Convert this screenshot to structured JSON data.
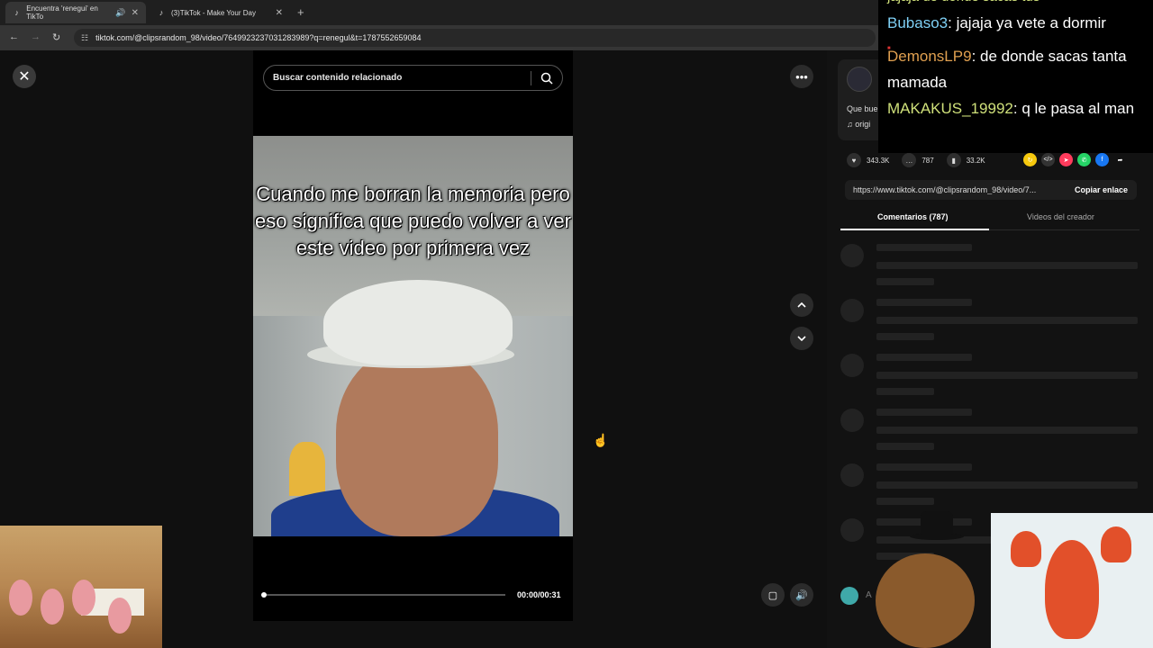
{
  "browser": {
    "tabs": [
      {
        "title": "Encuentra 'renegui' en TikTo",
        "active": true
      },
      {
        "title": "(3)TikTok - Make Your Day",
        "active": false
      }
    ],
    "url": "tiktok.com/@clipsrandom_98/video/7649923237031283989?q=renegul&t=1787552659084"
  },
  "player": {
    "search_placeholder": "Buscar contenido relacionado",
    "caption": "Cuando me borran la memoria pero eso significa que puedo volver a ver este video por primera vez",
    "time": "00:00/00:31",
    "progress": 0
  },
  "details": {
    "description": "Que bue",
    "music": "♫  origi",
    "likes": "343.3K",
    "comments": "787",
    "saves": "33.2K",
    "share_link": "https://www.tiktok.com/@clipsrandom_98/video/7...",
    "copy_label": "Copiar enlace",
    "tab_comments": "Comentarios (787)",
    "tab_creator": "Videos del creador",
    "comment_input_partial": "A"
  },
  "chat": [
    {
      "user": "Bubaso3",
      "message": "jajaja ya vete a dormir",
      "color": "#7fd0f5"
    },
    {
      "user": "DemonsLP9",
      "message": "de donde sacas tanta mamada",
      "color": "#e0a050"
    },
    {
      "user": "MAKAKUS_19992",
      "message": "q le pasa al man",
      "color": "#cfe07a"
    }
  ],
  "chat_partial_top": "jajaja de donde sacas tus",
  "colors": {
    "background": "#101010",
    "like": "#ffffff",
    "share_yellow": "#f6c90e",
    "share_red": "#ff3b5c",
    "share_green": "#25d366",
    "share_blue": "#1877f2"
  }
}
